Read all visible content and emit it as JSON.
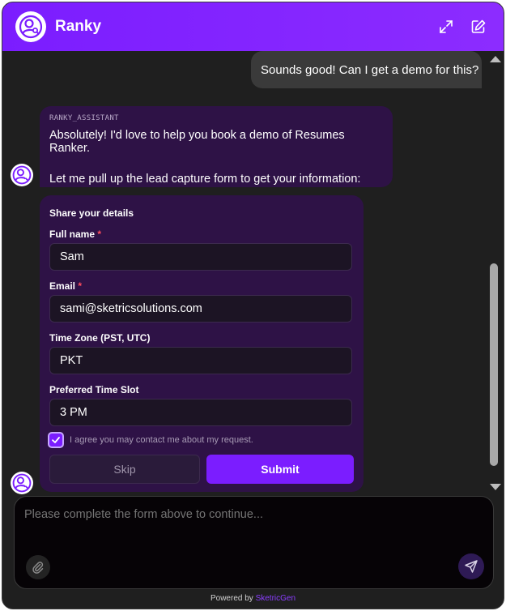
{
  "header": {
    "title": "Ranky",
    "icons": {
      "logo": "user-search-icon",
      "expand": "expand-icon",
      "edit": "edit-icon"
    },
    "accent": "#7b1dff"
  },
  "messages": {
    "user": {
      "text": "Sounds good! Can I get a demo for this?"
    },
    "assistant": {
      "sender": "RANKY_ASSISTANT",
      "line1": "Absolutely! I'd love to help you book a demo of Resumes Ranker.",
      "line2": "Let me pull up the lead capture form to get your information:"
    }
  },
  "form": {
    "title": "Share your details",
    "fields": [
      {
        "label": "Full name",
        "required_mark": "*",
        "value": "Sam"
      },
      {
        "label": "Email",
        "required_mark": "*",
        "value": "sami@sketricsolutions.com"
      },
      {
        "label": "Time Zone (PST, UTC)",
        "value": "PKT"
      },
      {
        "label": "Preferred Time Slot",
        "value": "3 PM"
      }
    ],
    "consent": {
      "checked": true,
      "text": "I agree you may contact me about my request."
    },
    "skip_label": "Skip",
    "submit_label": "Submit"
  },
  "composer": {
    "placeholder": "Please complete the form above to continue..."
  },
  "footer": {
    "prefix": "Powered by",
    "brand": "SketricGen"
  }
}
